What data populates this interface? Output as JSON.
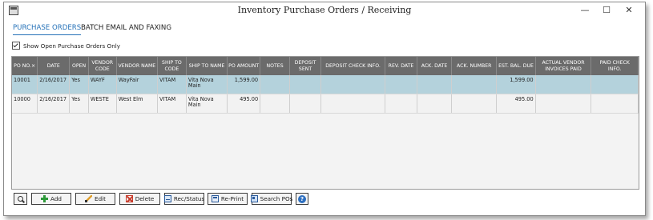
{
  "window": {
    "title": "Inventory Purchase Orders / Receiving",
    "controls": {
      "minimize": "—",
      "maximize": "☐",
      "close": "✕"
    }
  },
  "tabs": [
    {
      "label": "PURCHASE ORDERS",
      "active": true
    },
    {
      "label": "BATCH EMAIL AND FAXING",
      "active": false
    }
  ],
  "filter": {
    "label": "Show Open Purchase Orders Only",
    "checked": true
  },
  "table": {
    "columns": [
      "PO NO.×",
      "DATE",
      "OPEN",
      "VENDOR CODE",
      "VENDOR NAME",
      "SHIP TO CODE",
      "SHIP TO NAME",
      "PO AMOUNT",
      "NOTES",
      "DEPOSIT SENT",
      "DEPOSIT CHECK INFO.",
      "REV. DATE",
      "ACK. DATE",
      "ACK. NUMBER",
      "EST. BAL. DUE",
      "ACTUAL VENDOR INVOICES PAID",
      "PAID CHECK INFO."
    ],
    "rows": [
      {
        "po_no": "10001",
        "date": "2/16/2017",
        "open": "Yes",
        "vendor_code": "WAYF",
        "vendor_name": "WayFair",
        "ship_to_code": "VITAM",
        "ship_to_name": "Vita Nova Main",
        "po_amount": "1,599.00",
        "notes": "",
        "deposit_sent": "",
        "deposit_check_info": "",
        "rev_date": "",
        "ack_date": "",
        "ack_number": "",
        "est_bal_due": "1,599.00",
        "actual_vendor_invoices_paid": "",
        "paid_check_info": "",
        "selected": true
      },
      {
        "po_no": "10000",
        "date": "2/16/2017",
        "open": "Yes",
        "vendor_code": "WESTE",
        "vendor_name": "West Elm",
        "ship_to_code": "VITAM",
        "ship_to_name": "Vita Nova Main",
        "po_amount": "495.00",
        "notes": "",
        "deposit_sent": "",
        "deposit_check_info": "",
        "rev_date": "",
        "ack_date": "",
        "ack_number": "",
        "est_bal_due": "495.00",
        "actual_vendor_invoices_paid": "",
        "paid_check_info": "",
        "selected": false
      }
    ]
  },
  "toolbar": {
    "search_icon": "magnifier-icon",
    "add": "Add",
    "edit": "Edit",
    "delete": "Delete",
    "rec_status": "Rec/Status",
    "reprint": "Re-Print",
    "search_pos": "Search POs",
    "help_icon": "?"
  },
  "colors": {
    "header_bg": "#6b6b6b",
    "selected_row": "#b4d2dc",
    "active_tab": "#2672b8"
  }
}
